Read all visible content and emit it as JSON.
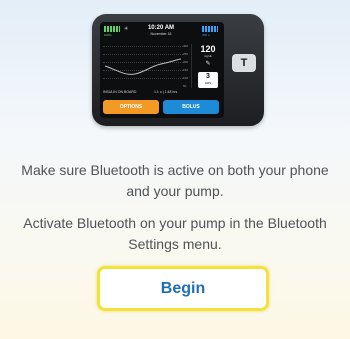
{
  "pump": {
    "time": "10:20 AM",
    "date": "November 16",
    "battery_left_label": "100%",
    "battery_right_label": "300 u",
    "bluetooth_icon": "bluetooth-icon",
    "bg_value": "120",
    "bg_unit": "mg/dL",
    "graph_ticks": [
      "400",
      "250",
      "200",
      "150",
      "100",
      "50"
    ],
    "units_value": "3",
    "units_label": "HRS",
    "iob_label": "INSULIN ON BOARD",
    "iob_value": "1.1 u | 1:48 hrs",
    "options_label": "OPTIONS",
    "bolus_label": "BOLUS",
    "side_button_label": "T"
  },
  "message": {
    "line1": "Make sure Bluetooth is active on both your phone and your pump.",
    "line2": "Activate Bluetooth on your pump in the Bluetooth Settings menu."
  },
  "actions": {
    "begin_label": "Begin"
  },
  "colors": {
    "accent_text": "#1f6fb6",
    "button_border": "#f2e23a",
    "options_orange": "#f39a24",
    "bolus_blue": "#1d8bd6"
  }
}
